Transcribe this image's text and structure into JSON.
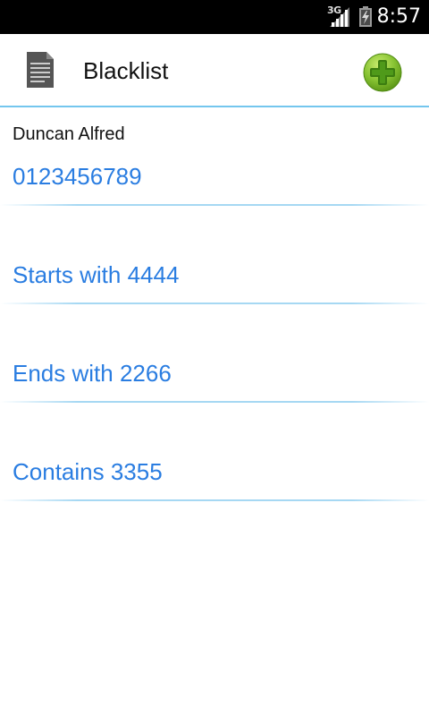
{
  "status_bar": {
    "network_type": "3G",
    "time": "8:57",
    "signal_icon": "cell-signal-icon",
    "battery_icon": "battery-charging-icon"
  },
  "action_bar": {
    "title": "Blacklist",
    "app_icon": "document-icon",
    "add_icon": "add-icon",
    "accent_color": "#74c6ee"
  },
  "items": [
    {
      "name": "Duncan Alfred",
      "value": "0123456789"
    },
    {
      "name": "",
      "value": "Starts with 4444"
    },
    {
      "name": "",
      "value": "Ends with 2266"
    },
    {
      "name": "",
      "value": "Contains 3355"
    }
  ],
  "colors": {
    "value_text": "#2a7de1",
    "add_button": "#7ab51d",
    "status_bar": "#000000"
  }
}
